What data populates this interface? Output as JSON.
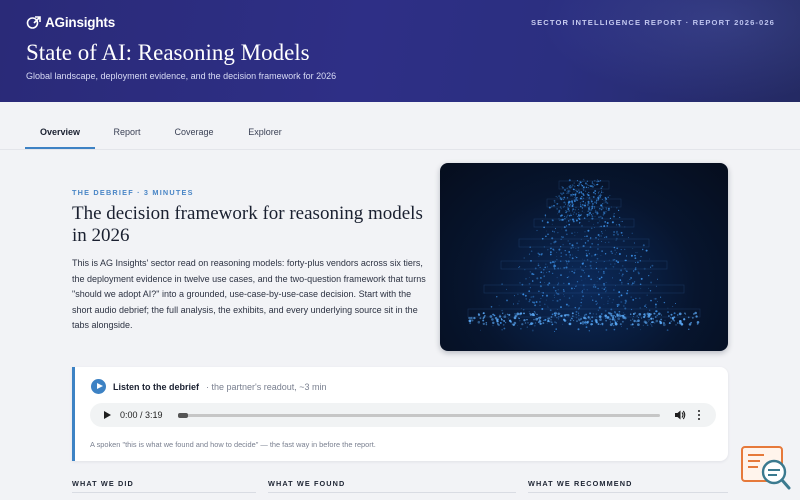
{
  "brand": {
    "logo_text": "AGinsights"
  },
  "header": {
    "report_id": "SECTOR INTELLIGENCE REPORT · REPORT 2026-026",
    "title": "State of AI: Reasoning Models",
    "subtitle": "Global landscape, deployment evidence, and the decision framework for 2026"
  },
  "tabs": [
    {
      "label": "Overview",
      "active": true
    },
    {
      "label": "Report",
      "active": false
    },
    {
      "label": "Coverage",
      "active": false
    },
    {
      "label": "Explorer",
      "active": false
    }
  ],
  "debrief": {
    "kicker": "THE DEBRIEF · 3 MINUTES",
    "heading": "The decision framework for reasoning models in 2026",
    "body": "This is AG Insights' sector read on reasoning models: forty-plus vendors across six tiers, the deployment evidence in twelve use cases, and the two-question framework that turns \"should we adopt AI?\" into a grounded, use-case-by-use-case decision. Start with the short audio debrief; the full analysis, the exhibits, and every underlying source sit in the tabs alongside."
  },
  "audio": {
    "title": "Listen to the debrief",
    "meta": "· the partner's readout, ~3 min",
    "time_display": "0:00 / 3:19",
    "progress_fraction": 0.0,
    "caption": "A spoken \"this is what we found and how to decide\" — the fast way in before the report."
  },
  "columns": [
    "WHAT WE DID",
    "WHAT WE FOUND",
    "WHAT WE RECOMMEND"
  ],
  "colors": {
    "hero_bg": "#2c2d80",
    "accent": "#3d82c4",
    "viz_glow": "#3b8fe6"
  },
  "icons": {
    "logo": "ag-logo-icon",
    "play": "play-icon",
    "volume": "volume-icon",
    "more": "more-vertical-icon",
    "search_doc": "search-document-icon"
  }
}
